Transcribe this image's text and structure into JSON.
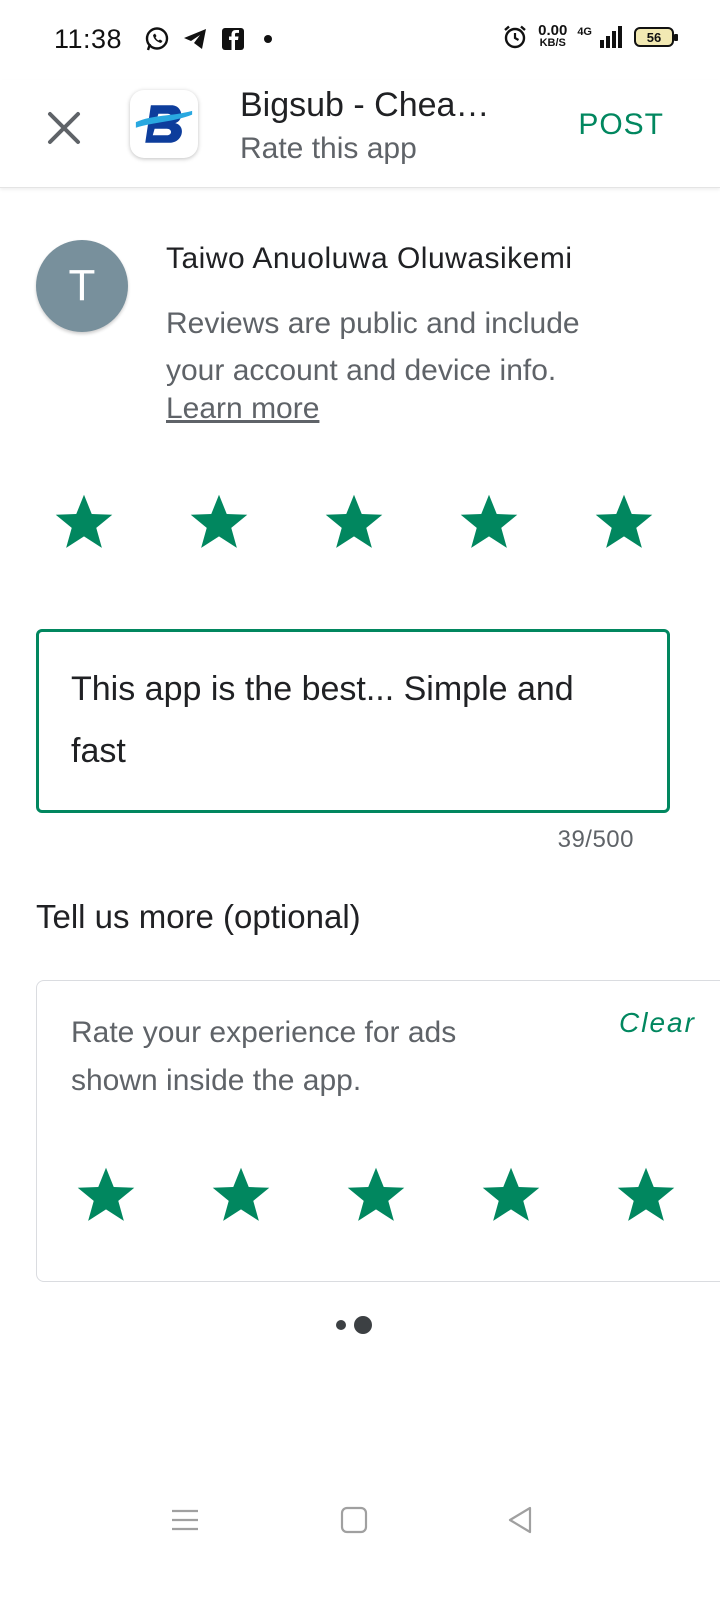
{
  "status_bar": {
    "time": "11:38",
    "left_icons": [
      "whatsapp-icon",
      "telegram-icon",
      "facebook-icon",
      "notification-dot"
    ],
    "alarm_icon": "alarm-icon",
    "net_speed_value": "0.00",
    "net_speed_unit": "KB/S",
    "network_type": "4G",
    "battery": "56"
  },
  "app_bar": {
    "close_icon": "close-icon",
    "app_title": "Bigsub - Chea…",
    "subtitle": "Rate this app",
    "post_label": "POST",
    "accent_color": "#01875f"
  },
  "account": {
    "avatar_letter": "T",
    "avatar_color": "#78909c",
    "name": "Taiwo Anuoluwa Oluwasikemi",
    "note": "Reviews are public and include your account and device info.",
    "learn_more": "Learn more"
  },
  "rating": {
    "value": 5,
    "max": 5,
    "star_color": "#01875f"
  },
  "review": {
    "text": "This app is the best... Simple and fast",
    "char_count": "39/500"
  },
  "tell_more": {
    "heading": "Tell us more (optional)",
    "ads_question": "Rate your experience for ads shown inside the app.",
    "clear_label": "Clear",
    "ads_rating": 5,
    "ads_rating_max": 5
  },
  "pager": {
    "pages": 2,
    "current": 2
  },
  "nav_bar": {
    "icons": [
      "menu-icon",
      "home-icon",
      "back-icon"
    ]
  }
}
